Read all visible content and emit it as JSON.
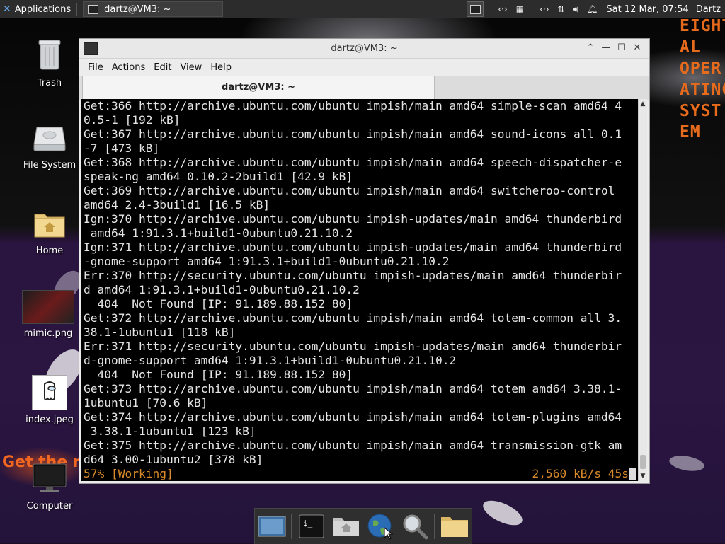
{
  "panel": {
    "applications_label": "Applications",
    "task_title": "dartz@VM3: ~",
    "clock": "Sat 12 Mar, 07:54",
    "user": "Dartz",
    "tray_icons": [
      "network-icon",
      "keyboard-icon",
      "network-activity-icon",
      "transfer-icon",
      "volume-icon",
      "notification-bell-icon"
    ]
  },
  "wallpaper_text": {
    "side_lines": "EIGHT\nAL\nOPER\nATING\nSYST\nEM",
    "bottom_left": "Get the m"
  },
  "desktop_icons": [
    {
      "label": "Trash",
      "icon": "trash-icon"
    },
    {
      "label": "File System",
      "icon": "drive-icon"
    },
    {
      "label": "Home",
      "icon": "home-folder-icon"
    },
    {
      "label": "mimic.png",
      "icon": "image-file-icon"
    },
    {
      "label": "index.jpeg",
      "icon": "image-file-icon"
    },
    {
      "label": "Computer",
      "icon": "computer-icon"
    }
  ],
  "window": {
    "title": "dartz@VM3: ~",
    "menu": [
      "File",
      "Actions",
      "Edit",
      "View",
      "Help"
    ],
    "tab_label": "dartz@VM3: ~"
  },
  "terminal": {
    "lines": [
      "Get:366 http://archive.ubuntu.com/ubuntu impish/main amd64 simple-scan amd64 4",
      "0.5-1 [192 kB]",
      "Get:367 http://archive.ubuntu.com/ubuntu impish/main amd64 sound-icons all 0.1",
      "-7 [473 kB]",
      "Get:368 http://archive.ubuntu.com/ubuntu impish/main amd64 speech-dispatcher-e",
      "speak-ng amd64 0.10.2-2build1 [42.9 kB]",
      "Get:369 http://archive.ubuntu.com/ubuntu impish/main amd64 switcheroo-control",
      "amd64 2.4-3build1 [16.5 kB]",
      "Ign:370 http://archive.ubuntu.com/ubuntu impish-updates/main amd64 thunderbird",
      " amd64 1:91.3.1+build1-0ubuntu0.21.10.2",
      "Ign:371 http://archive.ubuntu.com/ubuntu impish-updates/main amd64 thunderbird",
      "-gnome-support amd64 1:91.3.1+build1-0ubuntu0.21.10.2",
      "Err:370 http://security.ubuntu.com/ubuntu impish-updates/main amd64 thunderbir",
      "d amd64 1:91.3.1+build1-0ubuntu0.21.10.2",
      "  404  Not Found [IP: 91.189.88.152 80]",
      "Get:372 http://archive.ubuntu.com/ubuntu impish/main amd64 totem-common all 3.",
      "38.1-1ubuntu1 [118 kB]",
      "Err:371 http://security.ubuntu.com/ubuntu impish-updates/main amd64 thunderbir",
      "d-gnome-support amd64 1:91.3.1+build1-0ubuntu0.21.10.2",
      "  404  Not Found [IP: 91.189.88.152 80]",
      "Get:373 http://archive.ubuntu.com/ubuntu impish/main amd64 totem amd64 3.38.1-",
      "1ubuntu1 [70.6 kB]",
      "Get:374 http://archive.ubuntu.com/ubuntu impish/main amd64 totem-plugins amd64",
      " 3.38.1-1ubuntu1 [123 kB]",
      "Get:375 http://archive.ubuntu.com/ubuntu impish/main amd64 transmission-gtk am",
      "d64 3.00-1ubuntu2 [378 kB]"
    ],
    "status_left": "57% [Working]",
    "status_right": "2,560 kB/s 45s"
  },
  "dock": {
    "items": [
      "show-desktop-icon",
      "terminal-icon",
      "home-folder-icon",
      "web-browser-icon",
      "search-magnifier-icon",
      "folder-icon"
    ]
  },
  "colors": {
    "panel_bg": "#2c2c2c",
    "terminal_bg": "#000000",
    "terminal_fg": "#e5e5e5",
    "status_fg": "#d98a2a",
    "accent_orange": "#e76b1c"
  }
}
